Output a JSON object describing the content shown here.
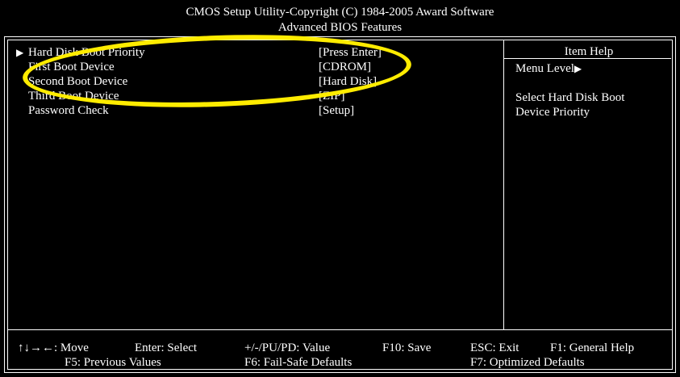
{
  "header": {
    "line1": "CMOS Setup Utility-Copyright (C) 1984-2005 Award Software",
    "line2": "Advanced BIOS Features"
  },
  "menu": [
    {
      "label": "Hard Disk Boot Priority",
      "value": "[Press Enter]",
      "submenu": true
    },
    {
      "label": "First Boot Device",
      "value": "[CDROM]",
      "submenu": false
    },
    {
      "label": "Second Boot Device",
      "value": "[Hard Disk]",
      "submenu": false
    },
    {
      "label": "Third Boot Device",
      "value": "[ZIP]",
      "submenu": false
    },
    {
      "label": "Password Check",
      "value": "[Setup]",
      "submenu": false
    }
  ],
  "help": {
    "title": "Item Help",
    "menu_level": "Menu Level",
    "menu_level_marker": "▶",
    "line1": "Select Hard Disk Boot",
    "line2": "Device Priority"
  },
  "footer": {
    "move": "↑↓→←: Move",
    "select": "Enter: Select",
    "value": "+/-/PU/PD: Value",
    "save": "F10: Save",
    "exit": "ESC: Exit",
    "general_help": "F1: General Help",
    "previous": "F5: Previous Values",
    "failsafe": "F6: Fail-Safe Defaults",
    "optimized": "F7: Optimized Defaults"
  },
  "markers": {
    "submenu_arrow": "▶"
  },
  "colors": {
    "background": "#000000",
    "text": "#ffffff",
    "highlight_ellipse": "#ffec00"
  }
}
